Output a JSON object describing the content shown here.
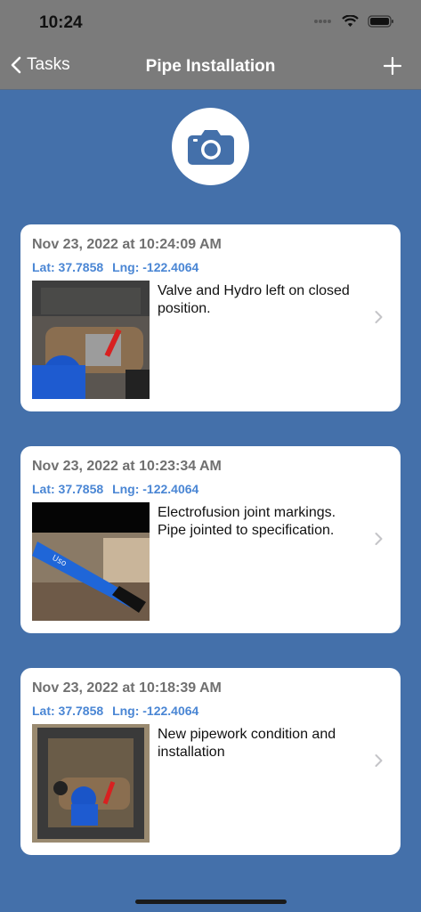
{
  "status": {
    "time": "10:24"
  },
  "nav": {
    "back_label": "Tasks",
    "title": "Pipe Installation"
  },
  "icons": {
    "back": "chevron-left-icon",
    "add": "plus-icon",
    "camera": "camera-icon",
    "row": "chevron-right-icon"
  },
  "colors": {
    "background": "#4470aa",
    "navbar": "#7b7b7b",
    "coords": "#4a86d4",
    "date": "#707070"
  },
  "entries": [
    {
      "date": "Nov 23, 2022 at 10:24:09 AM",
      "lat": "Lat: 37.7858",
      "lng": "Lng: -122.4064",
      "description": "Valve and Hydro left on closed position."
    },
    {
      "date": "Nov 23, 2022 at 10:23:34 AM",
      "lat": "Lat: 37.7858",
      "lng": "Lng: -122.4064",
      "description": "Electrofusion joint markings. Pipe jointed to specification."
    },
    {
      "date": "Nov 23, 2022 at 10:18:39 AM",
      "lat": "Lat: 37.7858",
      "lng": "Lng: -122.4064",
      "description": "New pipework condition and installation"
    }
  ]
}
